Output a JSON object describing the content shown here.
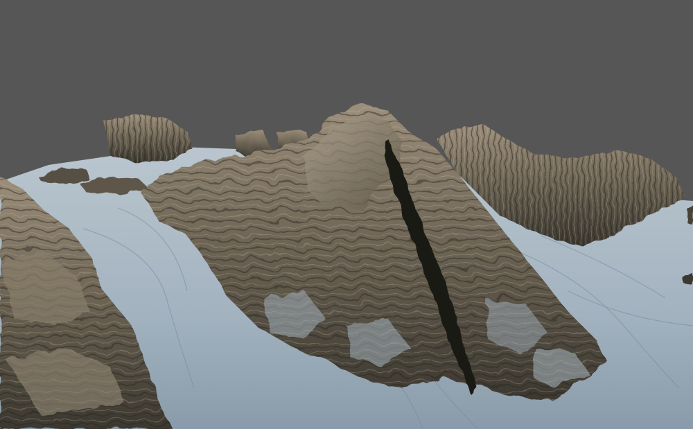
{
  "scene": {
    "subject": "terrain-3d-render",
    "colors": {
      "background": "#5a5a5a",
      "snow_light": "#c9d5de",
      "snow_mid": "#9fb1be",
      "snow_shadow": "#6f8190",
      "rock_light": "#9a8e7a",
      "rock_mid": "#6f6656",
      "rock_dark": "#3b372f",
      "rock_shadow": "#22201c"
    }
  }
}
